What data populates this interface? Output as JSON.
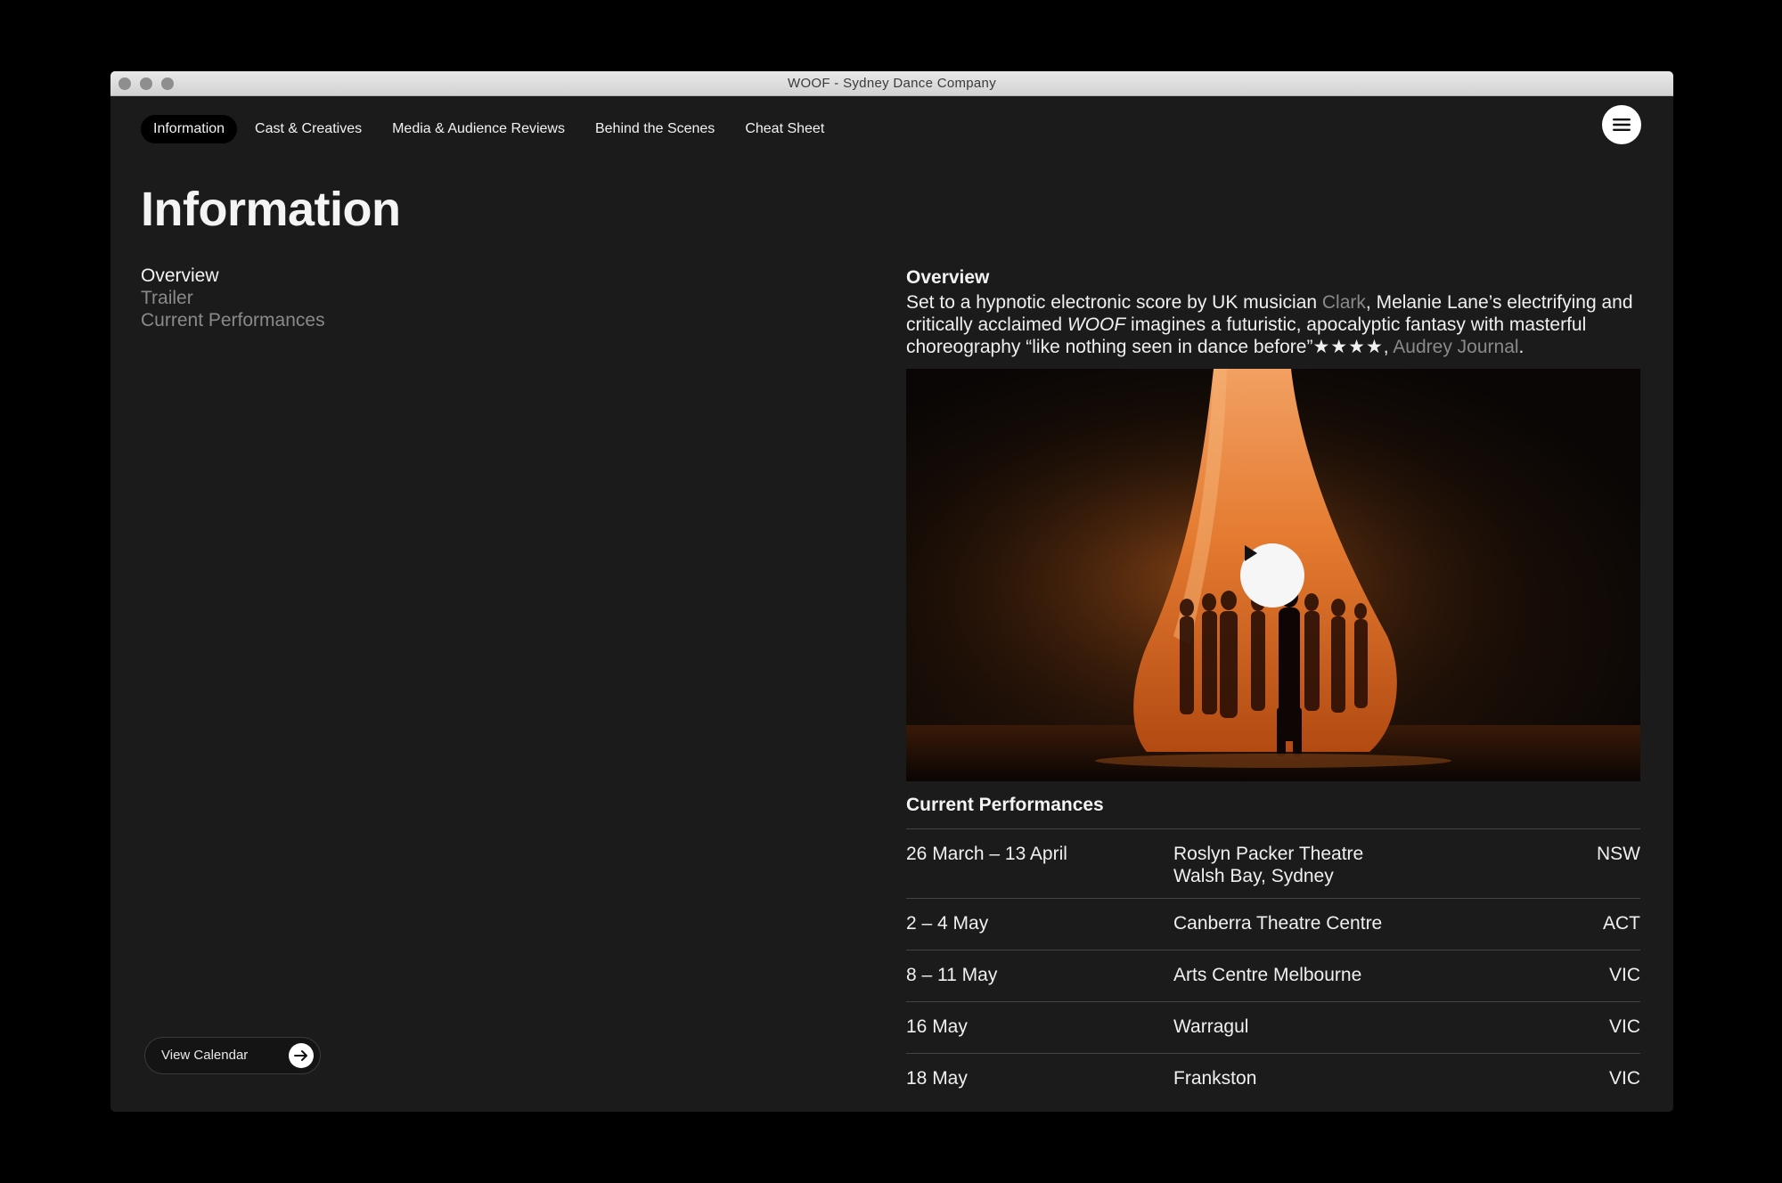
{
  "window": {
    "title": "WOOF - Sydney Dance Company"
  },
  "nav": {
    "tabs": [
      {
        "label": "Information",
        "active": true
      },
      {
        "label": "Cast & Creatives"
      },
      {
        "label": "Media & Audience Reviews"
      },
      {
        "label": "Behind the Scenes"
      },
      {
        "label": "Cheat Sheet"
      }
    ],
    "menu_icon": "hamburger-icon"
  },
  "page": {
    "title": "Information"
  },
  "subnav": {
    "items": [
      {
        "label": "Overview",
        "active": true
      },
      {
        "label": "Trailer"
      },
      {
        "label": "Current Performances"
      }
    ]
  },
  "calendar_button": {
    "label": "View Calendar",
    "icon": "arrow-right-icon"
  },
  "overview": {
    "heading": "Overview",
    "text_1": "Set to a hypnotic electronic score by UK musician ",
    "link_1": "Clark",
    "text_2": ", Melanie Lane’s electrifying and critically acclaimed ",
    "text_italic": "WOOF",
    "text_3": " imagines a futuristic, apocalyptic fantasy with masterful choreography “like nothing seen in dance before”",
    "stars": "★★★★",
    "text_4": ", ",
    "link_2": "Audrey Journal",
    "text_5": "."
  },
  "video": {
    "play_icon": "play-icon"
  },
  "performances": {
    "heading": "Current Performances",
    "rows": [
      {
        "dates": "26 March – 13 April",
        "venue": "Roslyn Packer Theatre",
        "venue_line2": "Walsh Bay, Sydney",
        "state": "NSW"
      },
      {
        "dates": "2 – 4 May",
        "venue": "Canberra Theatre Centre",
        "state": "ACT"
      },
      {
        "dates": "8 – 11 May",
        "venue": "Arts Centre Melbourne",
        "state": "VIC"
      },
      {
        "dates": "16 May",
        "venue": "Warragul",
        "state": "VIC"
      },
      {
        "dates": "18 May",
        "venue": "Frankston",
        "state": "VIC"
      }
    ]
  },
  "colors": {
    "background": "#1b1b1b",
    "text": "#f4f4f4",
    "muted": "#8a8a8a",
    "accent_stage": "#e07a2e"
  }
}
